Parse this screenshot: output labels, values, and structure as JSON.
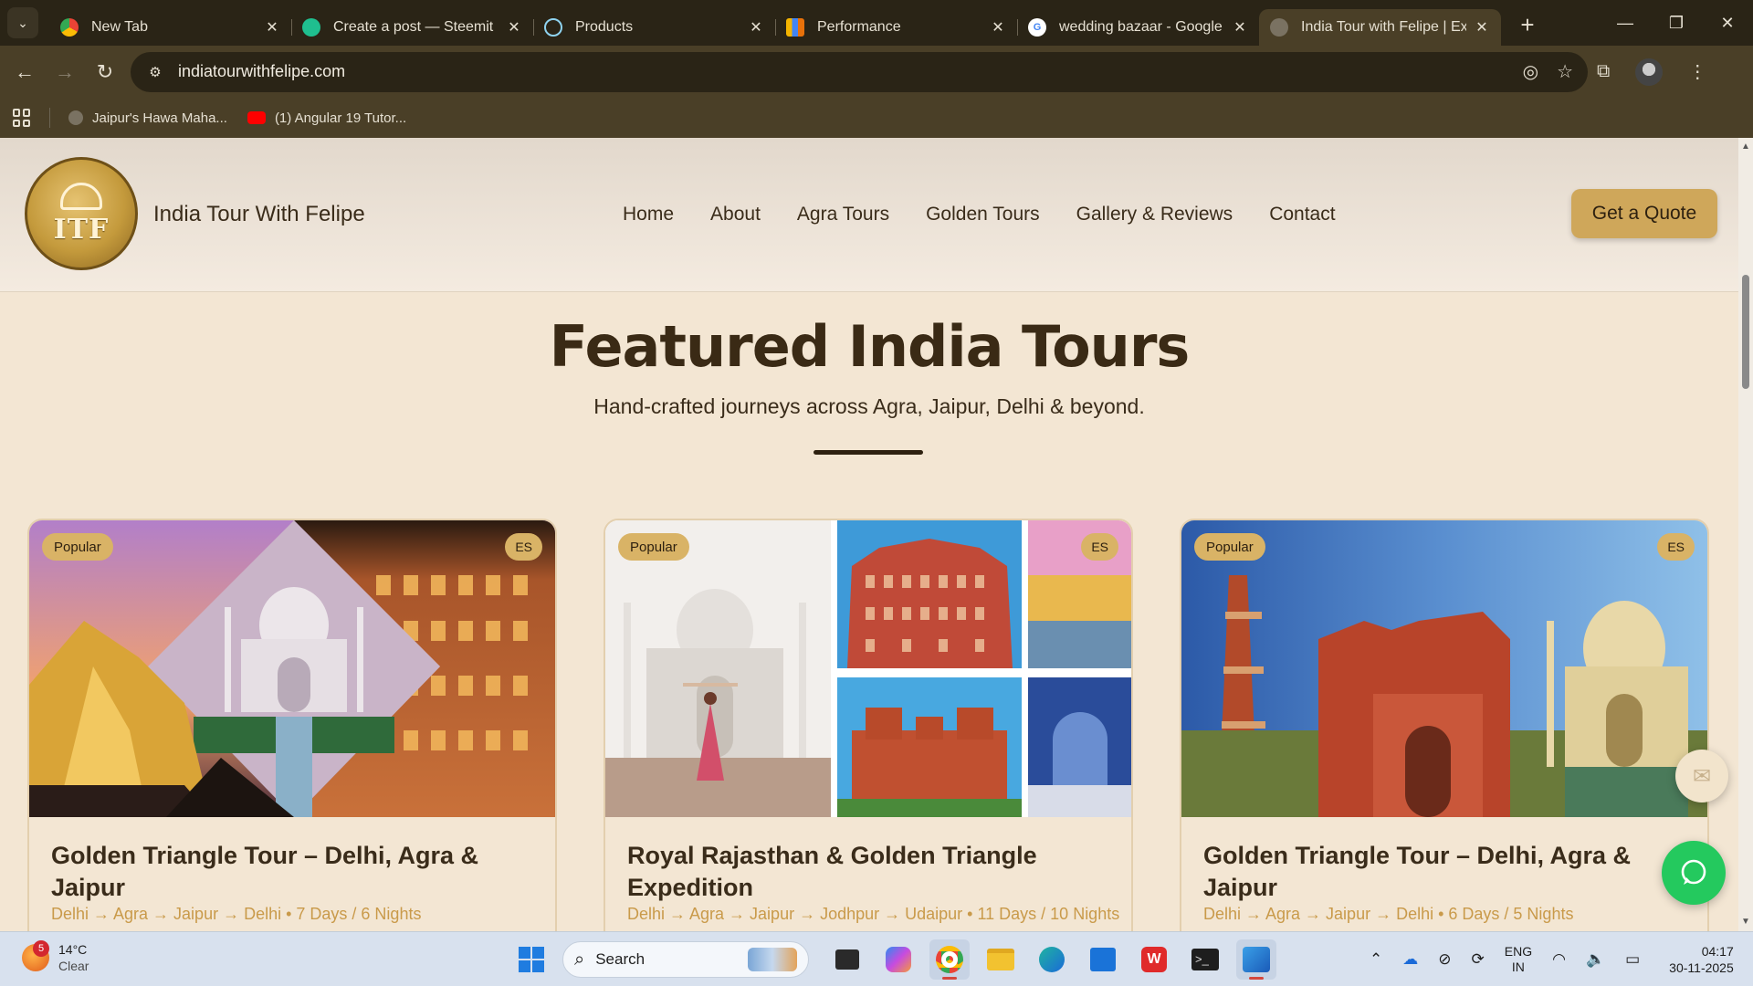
{
  "browser": {
    "tabs": [
      {
        "title": "New Tab",
        "favicon": "chrome-icon"
      },
      {
        "title": "Create a post — Steemit",
        "favicon": "steemit-icon"
      },
      {
        "title": "Products",
        "favicon": "products-icon"
      },
      {
        "title": "Performance",
        "favicon": "analytics-icon"
      },
      {
        "title": "wedding bazaar - Google S",
        "favicon": "google-icon"
      },
      {
        "title": "India Tour with Felipe | Exp",
        "favicon": "globe-icon",
        "active": true
      }
    ],
    "url": "indiatourwithfelipe.com",
    "bookmarks": [
      {
        "label": "Jaipur's Hawa Maha..."
      },
      {
        "label": "(1) Angular 19 Tutor..."
      }
    ]
  },
  "site": {
    "logo_text": "ITF",
    "brand": "India Tour With Felipe",
    "nav": [
      "Home",
      "About",
      "Agra Tours",
      "Golden Tours",
      "Gallery & Reviews",
      "Contact"
    ],
    "cta": "Get a Quote",
    "section": {
      "title": "Featured India Tours",
      "subtitle": "Hand-crafted journeys across Agra, Jaipur, Delhi & beyond."
    },
    "tours": [
      {
        "badge": "Popular",
        "lang": "ES",
        "title": "Golden Triangle Tour – Delhi, Agra & Jaipur",
        "route": "Delhi → Agra → Jaipur → Delhi • 7 Days / 6 Nights"
      },
      {
        "badge": "Popular",
        "lang": "ES",
        "title": "Royal Rajasthan & Golden Triangle Expedition",
        "route": "Delhi → Agra → Jaipur → Jodhpur → Udaipur • 11 Days / 10 Nights"
      },
      {
        "badge": "Popular",
        "lang": "ES",
        "title": "Golden Triangle Tour – Delhi, Agra & Jaipur",
        "route": "Delhi → Agra → Jaipur → Delhi • 6 Days / 5 Nights"
      }
    ]
  },
  "taskbar": {
    "weather_temp": "14°C",
    "weather_cond": "Clear",
    "weather_alerts": "5",
    "search_label": "Search",
    "lang_top": "ENG",
    "lang_bottom": "IN",
    "time": "04:17",
    "date": "30-11-2025"
  },
  "colors": {
    "page_bg": "#f3e6d3",
    "accent_gold": "#cfa75a",
    "route_text": "#c99a4a",
    "whatsapp": "#24c95e",
    "browser_frame": "#4a3f27"
  }
}
